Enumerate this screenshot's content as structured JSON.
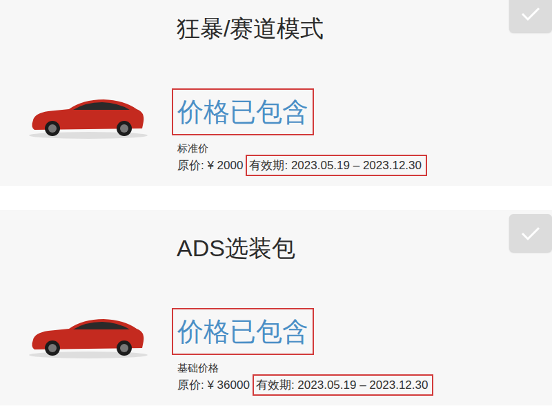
{
  "cards": [
    {
      "title": "狂暴/赛道模式",
      "checked": true,
      "price_label": "价格已包含",
      "price_highlighted": true,
      "price_type": "标准价",
      "original_price": "原价: ¥ 2000",
      "validity": "有效期: 2023.05.19 – 2023.12.30",
      "validity_highlighted": true
    },
    {
      "title": "ADS选装包",
      "checked": true,
      "price_label": "价格已包含",
      "price_highlighted": true,
      "price_type": "基础价格",
      "original_price": "原价: ¥ 36000",
      "validity": "有效期: 2023.05.19 – 2023.12.30",
      "validity_highlighted": true
    }
  ]
}
